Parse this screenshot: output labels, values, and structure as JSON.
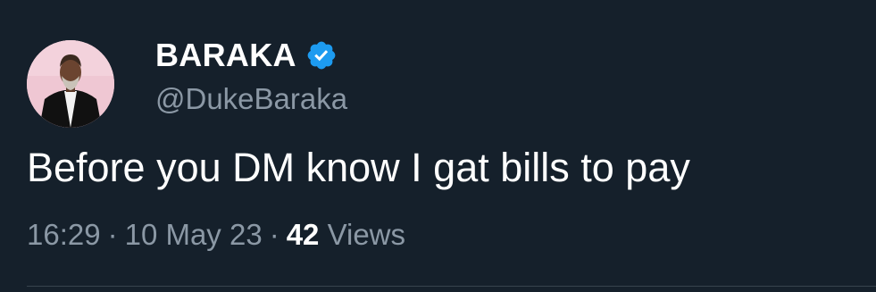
{
  "tweet": {
    "author": {
      "display_name": "BARAKA",
      "handle": "@DukeBaraka",
      "verified": true,
      "avatar_icon": "profile-photo"
    },
    "text": "Before you DM know I gat bills to pay",
    "time": "16:29",
    "date": "10 May 23",
    "views_count": "42",
    "views_label": "Views",
    "separator": "·"
  },
  "colors": {
    "background": "#15202b",
    "primary_text": "#ffffff",
    "secondary_text": "#8b98a5",
    "verified_badge": "#1d9bf0",
    "divider": "#38444d"
  }
}
